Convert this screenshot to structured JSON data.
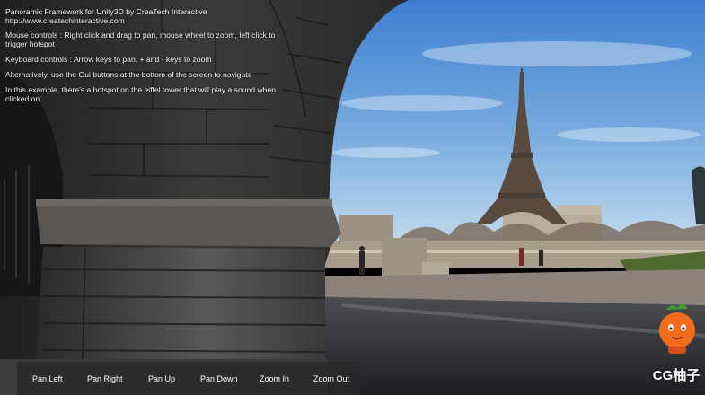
{
  "instructions": {
    "title": "Panoramic Framework for Unity3D by CreaTech Interactive",
    "url": "http://www.createchinteractive.com",
    "mouse": "Mouse controls : Right click and drag to pan, mouse wheel to zoom, left click to trigger hotspot",
    "keyboard": "Keyboard controls : Arrow keys to pan, + and - keys to zoom",
    "gui": "Alternatively, use the Gui buttons at the bottom of the screen to navigate",
    "hotspot": "In this example, there's a hotspot on the eiffel tower that will play a sound when clicked on"
  },
  "nav": {
    "pan_left": "Pan Left",
    "pan_right": "Pan Right",
    "pan_up": "Pan Up",
    "pan_down": "Pan Down",
    "zoom_in": "Zoom In",
    "zoom_out": "Zoom Out"
  },
  "watermark": {
    "text": "CG柚子"
  },
  "colors": {
    "sky_top": "#3d7fcf",
    "sky_bottom": "#b9d6ee",
    "nav_bg": "#282828",
    "watermark_orange": "#f26b1d"
  }
}
